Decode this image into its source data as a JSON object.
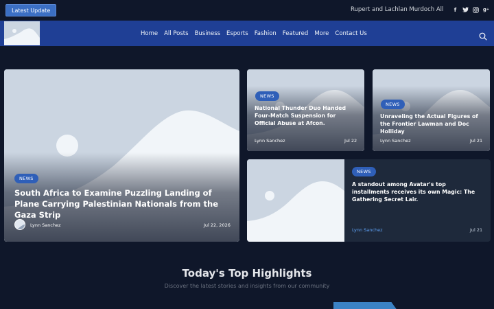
{
  "topbar": {
    "latest_label": "Latest Update",
    "ticker_text": "Rupert and Lachlan Murdoch Allegedl",
    "social_icons": [
      "facebook-icon",
      "twitter-icon",
      "instagram-icon",
      "google-plus-icon"
    ]
  },
  "nav": {
    "items": [
      "Home",
      "All Posts",
      "Business",
      "Esports",
      "Fashion",
      "Featured",
      "More",
      "Contact Us"
    ]
  },
  "featured": {
    "badge": "NEWS",
    "title": "South Africa to Examine Puzzling Landing of Plane Carrying Palestinian Nationals from the Gaza Strip",
    "author": "Lynn Sanchez",
    "date": "Jul 22, 2026"
  },
  "card_two": {
    "badge": "NEWS",
    "title": "National Thunder Duo Handed Four-Match Suspension for Official Abuse at Afcon.",
    "author": "Lynn Sanchez",
    "date": "Jul 22"
  },
  "card_three": {
    "badge": "NEWS",
    "title": "Unraveling the Actual Figures of the Frontier Lawman and Doc Holliday",
    "author": "Lynn Sanchez",
    "date": "Jul 21"
  },
  "card_four": {
    "badge": "NEWS",
    "title": "A standout among Avatar's top installments receives its own Magic: The Gathering Secret Lair.",
    "author": "Lynn Sanchez",
    "date": "Jul 21"
  },
  "highlights": {
    "title": "Today's Top Highlights",
    "subtitle": "Discover the latest stories and insights from our community"
  },
  "colors": {
    "background": "#0f172a",
    "navbar": "#1f3f95",
    "accent": "#2f5fb8",
    "author_link": "#60a5fa"
  }
}
